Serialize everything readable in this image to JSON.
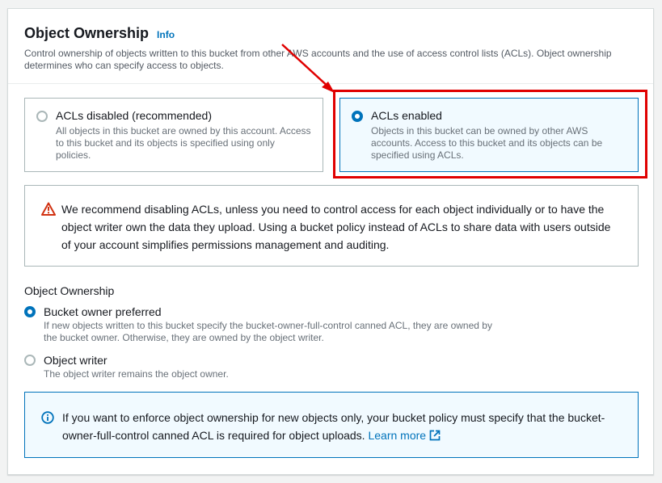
{
  "header": {
    "title": "Object Ownership",
    "info_link": "Info",
    "description": "Control ownership of objects written to this bucket from other AWS accounts and the use of access control lists (ACLs). Object ownership determines who can specify access to objects."
  },
  "acl_tiles": [
    {
      "label": "ACLs disabled (recommended)",
      "description": "All objects in this bucket are owned by this account. Access to this bucket and its objects is specified using only policies.",
      "selected": false
    },
    {
      "label": "ACLs enabled",
      "description": "Objects in this bucket can be owned by other AWS accounts. Access to this bucket and its objects can be specified using ACLs.",
      "selected": true
    }
  ],
  "warning": {
    "icon": "warning-triangle-icon",
    "text": "We recommend disabling ACLs, unless you need to control access for each object individually or to have the object writer own the data they upload. Using a bucket policy instead of ACLs to share data with users outside of your account simplifies permissions management and auditing."
  },
  "ownership": {
    "label": "Object Ownership",
    "options": [
      {
        "label": "Bucket owner preferred",
        "description": "If new objects written to this bucket specify the bucket-owner-full-control canned ACL, they are owned by the bucket owner. Otherwise, they are owned by the object writer.",
        "selected": true
      },
      {
        "label": "Object writer",
        "description": "The object writer remains the object owner.",
        "selected": false
      }
    ]
  },
  "info_alert": {
    "icon": "info-circle-icon",
    "text": "If you want to enforce object ownership for new objects only, your bucket policy must specify that the bucket-owner-full-control canned ACL is required for object uploads.",
    "link_text": "Learn more",
    "link_icon": "external-link-icon"
  },
  "colors": {
    "accent": "#0073bb",
    "annotation": "#e00000",
    "warning": "#d13212"
  }
}
